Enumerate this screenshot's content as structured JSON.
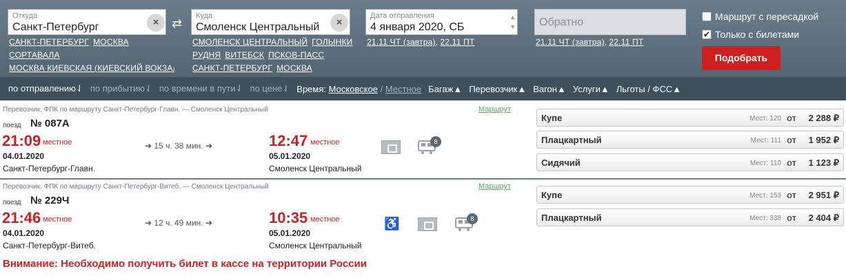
{
  "search": {
    "from_label": "Откуда",
    "from_value": "Санкт-Петербург",
    "from_quick": [
      "САНКТ-ПЕТЕРБУРГ",
      "МОСКВА",
      "СОРТАВАЛА",
      "МОСКВА КИЕВСКАЯ (КИЕВСКИЙ ВОКЗАЛ"
    ],
    "to_label": "Куда",
    "to_value": "Смоленск Центральный",
    "to_quick": [
      "СМОЛЕНСК ЦЕНТРАЛЬНЫЙ",
      "ГОЛЫНКИ",
      "РУДНЯ",
      "ВИТЕБСК",
      "ПСКОВ-ПАСС",
      "САНКТ-ПЕТЕРБУРГ",
      "МОСКВА"
    ],
    "date_label": "Дата отправления",
    "date_value": "4 января 2020, СБ",
    "date_quick": [
      "21.11 ЧТ (завтра)",
      "22.11 ПТ"
    ],
    "return_placeholder": "Обратно",
    "return_quick": [
      "21.11 ЧТ (завтра)",
      "22.11 ПТ"
    ],
    "transfer_label": "Маршрут с пересадкой",
    "tickets_only_label": "Только с билетами",
    "find_button": "Подобрать",
    "swap_icon": "⇄",
    "clear_icon": "×"
  },
  "sortbar": {
    "by_departure": "по отправлению",
    "by_arrival": "по прибытию",
    "by_duration": "по времени в пути",
    "by_price": "по цене",
    "time_label": "Время:",
    "time_moscow": "Московское",
    "time_separator": "/",
    "time_local": "Местное",
    "baggage": "Багаж",
    "carrier": "Перевозчик",
    "wagon": "Вагон",
    "services": "Услуги",
    "benefits": "Льготы / ФСС"
  },
  "trains": [
    {
      "carrier_line": "Перевозчик: ФПК  по маршруту Санкт-Петербург-Главн. — Смоленск Центральный",
      "route_link": "Маршрут",
      "train_label": "поезд",
      "number": "№ 087А",
      "dep_time": "21:09",
      "dep_tz": "местное",
      "dep_date": "04.01.2020",
      "dep_station": "Санкт-Петербург-Главн.",
      "duration": "15 ч. 38 мин.",
      "arr_time": "12:47",
      "arr_tz": "местное",
      "arr_date": "05.01.2020",
      "arr_station": "Смоленск Центральный",
      "wagon_badge": "8",
      "fares": [
        {
          "class": "Купе",
          "seats": "Мест: 120",
          "from": "от",
          "price": "2 288 ₽"
        },
        {
          "class": "Плацкартный",
          "seats": "Мест: 111",
          "from": "от",
          "price": "1 952 ₽"
        },
        {
          "class": "Сидячий",
          "seats": "Мест: 110",
          "from": "от",
          "price": "1 123 ₽"
        }
      ]
    },
    {
      "carrier_line": "Перевозчик: ФПК  по маршруту Санкт-Петербург-Витеб. — Смоленск Центральный",
      "route_link": "Маршрут",
      "train_label": "поезд",
      "number": "№ 229Ч",
      "dep_time": "21:46",
      "dep_tz": "местное",
      "dep_date": "04.01.2020",
      "dep_station": "Санкт-Петербург-Витеб.",
      "duration": "12 ч. 49 мин.",
      "arr_time": "10:35",
      "arr_tz": "местное",
      "arr_date": "05.01.2020",
      "arr_station": "Смоленск Центральный",
      "wagon_badge": "8",
      "fares": [
        {
          "class": "Купе",
          "seats": "Мест: 153",
          "from": "от",
          "price": "2 951 ₽"
        },
        {
          "class": "Плацкартный",
          "seats": "Мест: 338",
          "from": "от",
          "price": "2 404 ₽"
        }
      ]
    }
  ],
  "warning": "Внимание: Необходимо получить билет в кассе на территории России"
}
